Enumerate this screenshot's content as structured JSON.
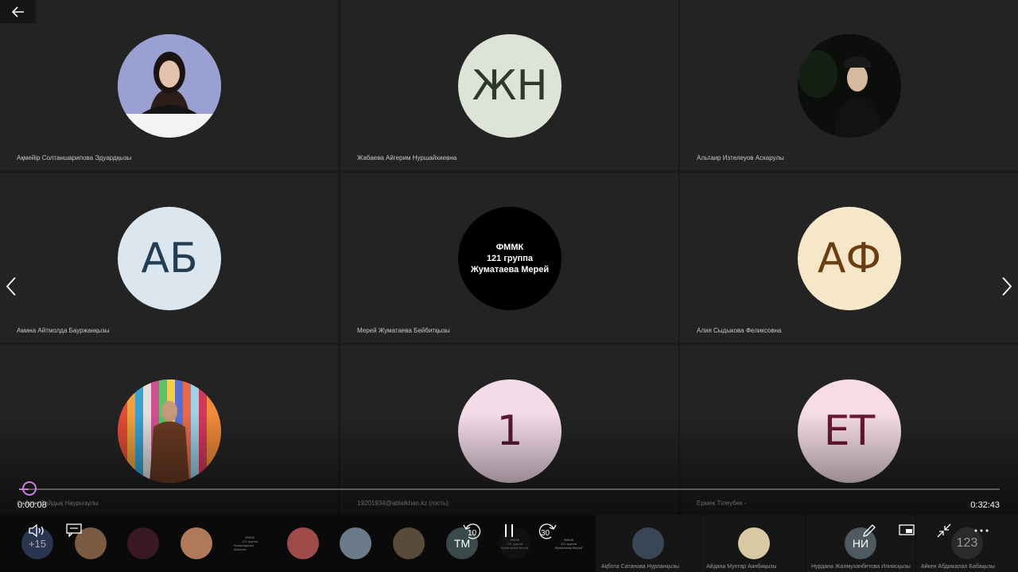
{
  "participants": [
    {
      "name": "Ақмейір Солтаншарипова Эдуардқызы",
      "type": "photo",
      "bg": "#8d95c8"
    },
    {
      "name": "Жабаева Айгерим Нуршайхиевна",
      "type": "initials",
      "initials": "ЖН",
      "bg": "#dde3d6",
      "fg": "#2d3a27"
    },
    {
      "name": "Альтаир Изтелеуов Аскарулы",
      "type": "photo",
      "bg": "#0c0f0c"
    },
    {
      "name": "Амина Айтмолда Бауржанқызы",
      "type": "initials",
      "initials": "АБ",
      "bg": "#dbe6ee",
      "fg": "#223e54"
    },
    {
      "name": "Мерей Жуматаева Бейбитқызы",
      "type": "text",
      "lines": [
        "ФММК",
        "121 группа",
        "Жуматаева Мерей"
      ],
      "bg": "#000000",
      "fg": "#ffffff"
    },
    {
      "name": "Алия Сыдыкова Феликсовна",
      "type": "initials",
      "initials": "АФ",
      "bg": "#f7e7c9",
      "fg": "#6a3e10"
    },
    {
      "name": "Сайрақ Сайдық Наурызұлы",
      "type": "photo",
      "bg": "#c2683e"
    },
    {
      "name": "19201934@ablaikhan.kz (гость)",
      "type": "initials",
      "initials": "1",
      "bg": "#f3dbe8",
      "fg": "#5a1832"
    },
    {
      "name": "Ермек Тілеубек -",
      "type": "initials",
      "initials": "ЕТ",
      "bg": "#f5dce6",
      "fg": "#6a1a32"
    }
  ],
  "player": {
    "current_time": "0:00:08",
    "total_time": "0:32:43",
    "progress": 0.004,
    "rewind_label": "10",
    "forward_label": "30",
    "accent": "#c37bd4"
  },
  "strip": {
    "more_count": "+15",
    "mini_initials": "ТМ",
    "mini_text_lines": [
      "ФММК",
      "121 группа",
      "Жуматаева Мерей"
    ],
    "mini_text_lines_b": [
      "ФММК",
      "121 группа",
      "Бекмолдиева Айгерим"
    ],
    "tiles": [
      {
        "name": "Ақбота Сатанова Нурланқызы",
        "bg": "#3a4656"
      },
      {
        "name": "Айдана Мухтар Аянбиқызы",
        "bg": "#d8c9a3"
      },
      {
        "name": "Нурдана Жалмуханбетова Илиясқызы",
        "initials": "НИ",
        "bg": "#4f5a60"
      },
      {
        "name": "Айкен Абдижалал Бабақызы",
        "initials": "123",
        "bg": "#2a2a2a"
      }
    ]
  },
  "icons": {
    "back": "arrow-left-icon",
    "prev": "chevron-left-icon",
    "next": "chevron-right-icon",
    "volume": "volume-icon",
    "captions": "captions-icon",
    "rewind": "rewind-10-icon",
    "pause": "pause-icon",
    "forward": "forward-30-icon",
    "pen": "pen-icon",
    "miniplayer": "miniplayer-icon",
    "exit_fullscreen": "exit-fullscreen-icon",
    "more": "more-icon"
  }
}
